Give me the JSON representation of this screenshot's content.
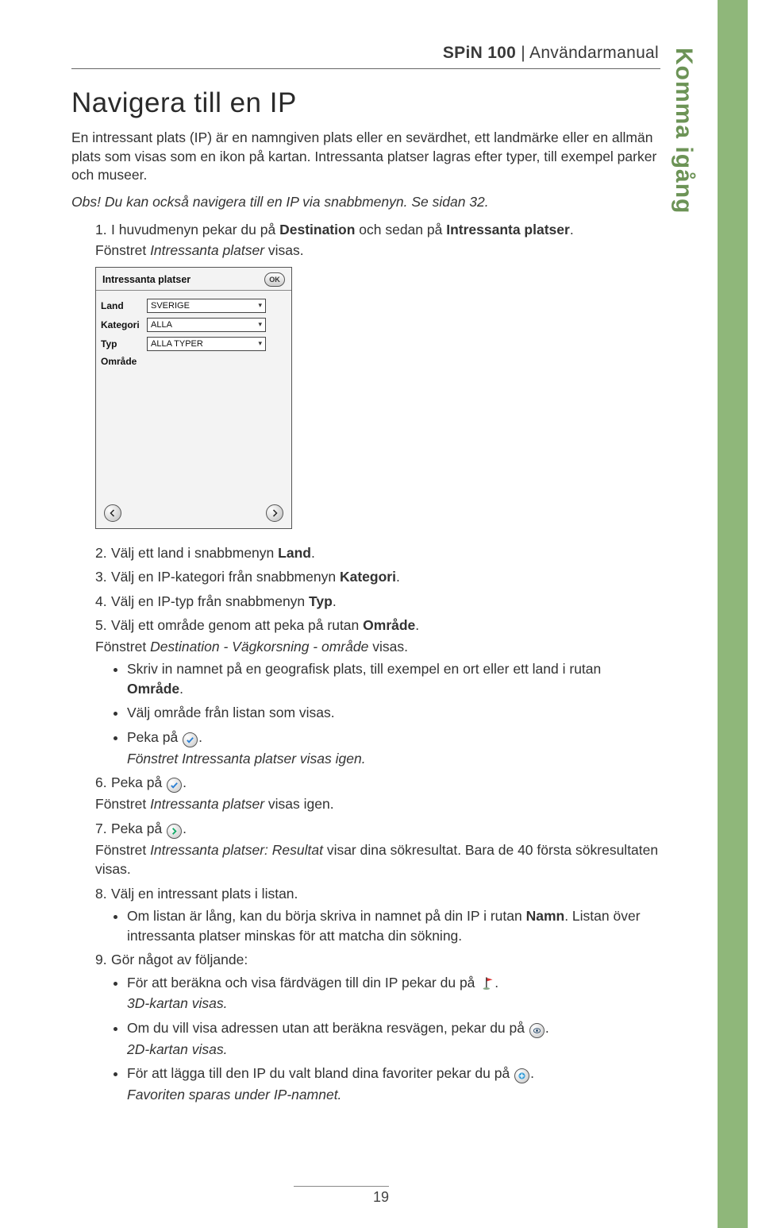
{
  "header": {
    "product": "SPiN 100",
    "doc": "Användarmanual"
  },
  "section_tab": "Komma igång",
  "title": "Navigera till en IP",
  "intro_a": "En intressant plats (IP) är en namngiven plats eller en sevärdhet, ett landmärke eller en allmän plats som visas som en ikon på kartan. Intressanta platser lagras efter typer, till exempel parker och museer.",
  "note_prefix": "Obs!",
  "note_body": " Du kan också navigera till en IP via snabbmenyn. Se sidan 32.",
  "step1_a": "I huvudmenyn pekar du på ",
  "step1_dest": "Destination",
  "step1_mid": " och sedan på ",
  "step1_ip": "Intressanta platser",
  "step1_end": ".",
  "step1_sub_a": "Fönstret ",
  "step1_sub_em": "Intressanta platser",
  "step1_sub_b": " visas.",
  "device": {
    "title": "Intressanta platser",
    "ok": "OK",
    "rows": {
      "land": {
        "label": "Land",
        "value": "SVERIGE"
      },
      "kategori": {
        "label": "Kategori",
        "value": "ALLA"
      },
      "typ": {
        "label": "Typ",
        "value": "ALLA TYPER"
      },
      "omrade": {
        "label": "Område",
        "value": ""
      }
    }
  },
  "step2_a": "Välj ett land i snabbmenyn ",
  "step2_b": "Land",
  "step3_a": "Välj en IP-kategori från snabbmenyn ",
  "step3_b": "Kategori",
  "step4_a": "Välj en IP-typ från snabbmenyn ",
  "step4_b": "Typ",
  "step5_a": "Välj ett område genom att peka på rutan ",
  "step5_b": "Område",
  "step5_sub_a": "Fönstret ",
  "step5_sub_em": "Destination - Vägkorsning - område",
  "step5_sub_b": " visas.",
  "step5_bul1_a": "Skriv in namnet på en geografisk plats, till exempel en ort eller ett land i rutan ",
  "step5_bul1_b": "Område",
  "step5_bul2": "Välj område från listan som visas.",
  "step5_bul3_a": "Peka på ",
  "step5_bul3_sub_a": "Fönstret ",
  "step5_bul3_sub_em": "Intressanta platser",
  "step5_bul3_sub_b": " visas igen.",
  "step6_a": "Peka på ",
  "step6_sub_a": "Fönstret ",
  "step6_sub_em": "Intressanta platser",
  "step6_sub_b": " visas igen.",
  "step7_a": "Peka på ",
  "step7_sub_a": "Fönstret ",
  "step7_sub_em": "Intressanta platser: Resultat",
  "step7_sub_b": " visar dina sökresultat. Bara de 40 första sökresultaten visas.",
  "step8": "Välj en intressant plats i listan.",
  "step8_bul_a": "Om listan är lång, kan du börja skriva in namnet på din IP i rutan ",
  "step8_bul_b": "Namn",
  "step8_bul_c": ". Listan över intressanta platser minskas för att matcha din sökning.",
  "step9": "Gör något av följande:",
  "step9_bul1_a": "För att beräkna och visa färdvägen till din IP pekar du på ",
  "step9_bul1_sub": "3D-kartan",
  "step9_bul1_sub_b": " visas.",
  "step9_bul2_a": "Om du vill visa adressen utan att beräkna resvägen, pekar du på ",
  "step9_bul2_sub": "2D-kartan visas.",
  "step9_bul3_a": "För att lägga till den IP du valt bland dina favoriter pekar du på ",
  "step9_bul3_sub": "Favoriten sparas under IP-namnet.",
  "page_number": "19"
}
